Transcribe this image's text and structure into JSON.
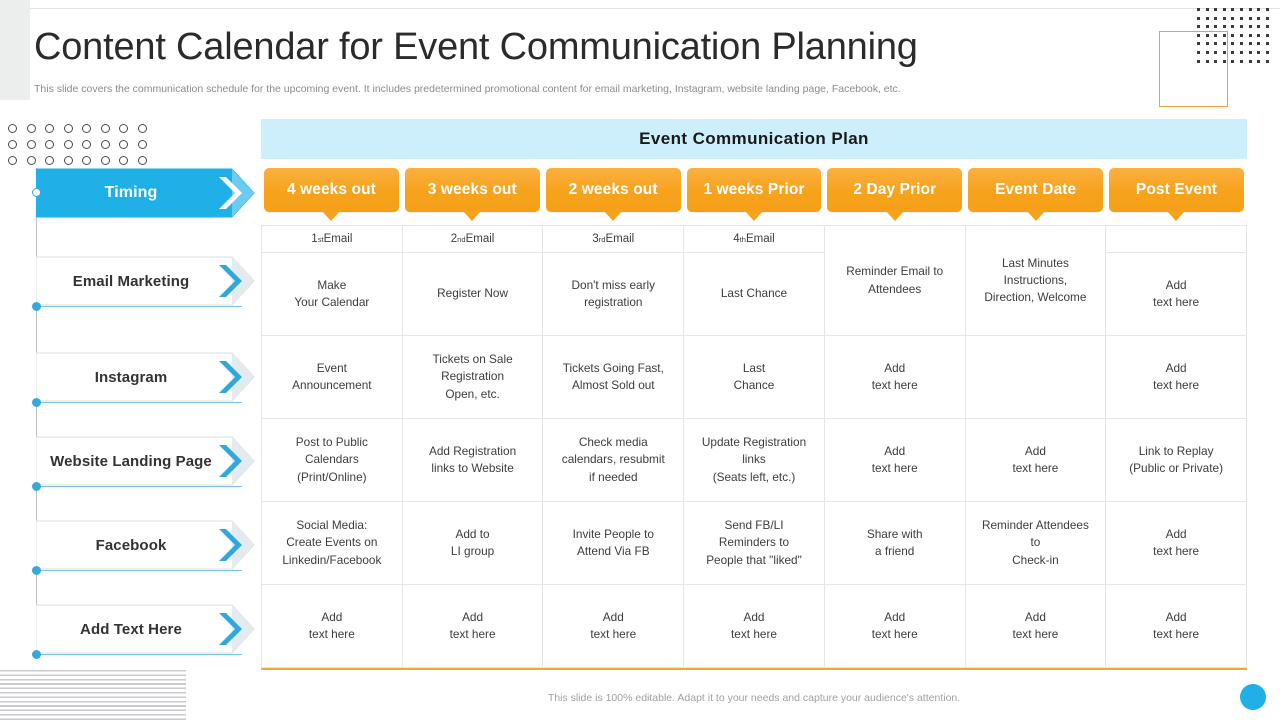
{
  "slide": {
    "title": "Content Calendar for Event Communication Planning",
    "subtitle": "This slide covers the communication schedule for the upcoming event. It includes predetermined promotional content for email marketing, Instagram, website landing page, Facebook, etc.",
    "footer_note": "This slide is 100% editable. Adapt it to your needs and capture your audience's attention."
  },
  "colors": {
    "accent_blue": "#1fb0e8",
    "accent_orange": "#f7a21b",
    "banner_blue": "#cdeefb",
    "title_text": "#2b2b2b",
    "grid_line": "#e6e6e6"
  },
  "panel": {
    "banner_title": "Event Communication Plan"
  },
  "nav": {
    "items": [
      {
        "label": "Timing",
        "active": true
      },
      {
        "label": "Email Marketing",
        "active": false
      },
      {
        "label": "Instagram",
        "active": false
      },
      {
        "label": "Website Landing Page",
        "active": false
      },
      {
        "label": "Facebook",
        "active": false
      },
      {
        "label": "Add Text Here",
        "active": false
      }
    ]
  },
  "table": {
    "columns": [
      "4 weeks out",
      "3 weeks out",
      "2 weeks out",
      "1 weeks Prior",
      "2 Day Prior",
      "Event Date",
      "Post Event"
    ],
    "email_subheaders": [
      {
        "ordinal": "1",
        "suffix": "st",
        "text": "Email"
      },
      {
        "ordinal": "2",
        "suffix": "nd",
        "text": " Email"
      },
      {
        "ordinal": "3",
        "suffix": "rd",
        "text": " Email"
      },
      {
        "ordinal": "4",
        "suffix": "th",
        "text": " Email"
      }
    ],
    "rows": [
      {
        "name": "Email Marketing",
        "cells": [
          "Make\nYour Calendar",
          "Register Now",
          "Don't miss early\nregistration",
          "Last Chance",
          "Reminder Email to\nAttendees",
          "Last Minutes\nInstructions,\nDirection, Welcome",
          "Add\ntext here"
        ]
      },
      {
        "name": "Instagram",
        "cells": [
          "Event\nAnnouncement",
          "Tickets on Sale\nRegistration\nOpen, etc.",
          "Tickets Going Fast,\nAlmost Sold out",
          "Last\nChance",
          "Add\ntext here",
          "",
          "Add\ntext here"
        ]
      },
      {
        "name": "Website Landing Page",
        "cells": [
          "Post to Public\nCalendars\n(Print/Online)",
          "Add Registration\nlinks to Website",
          "Check media\ncalendars, resubmit\nif needed",
          "Update Registration\nlinks\n(Seats left, etc.)",
          "Add\ntext here",
          "Add\ntext here",
          "Link to Replay\n(Public or Private)"
        ]
      },
      {
        "name": "Facebook",
        "cells": [
          "Social Media:\nCreate Events on\nLinkedin/Facebook",
          "Add to\nLI group",
          "Invite People to\nAttend Via FB",
          "Send FB/LI\nReminders to\nPeople that \"liked\"",
          "Share with\na friend",
          "Reminder Attendees\nto\nCheck-in",
          "Add\ntext here"
        ]
      },
      {
        "name": "Add Text Here",
        "cells": [
          "Add\ntext here",
          "Add\ntext here",
          "Add\ntext here",
          "Add\ntext here",
          "Add\ntext here",
          "Add\ntext here",
          "Add\ntext here"
        ]
      }
    ]
  }
}
